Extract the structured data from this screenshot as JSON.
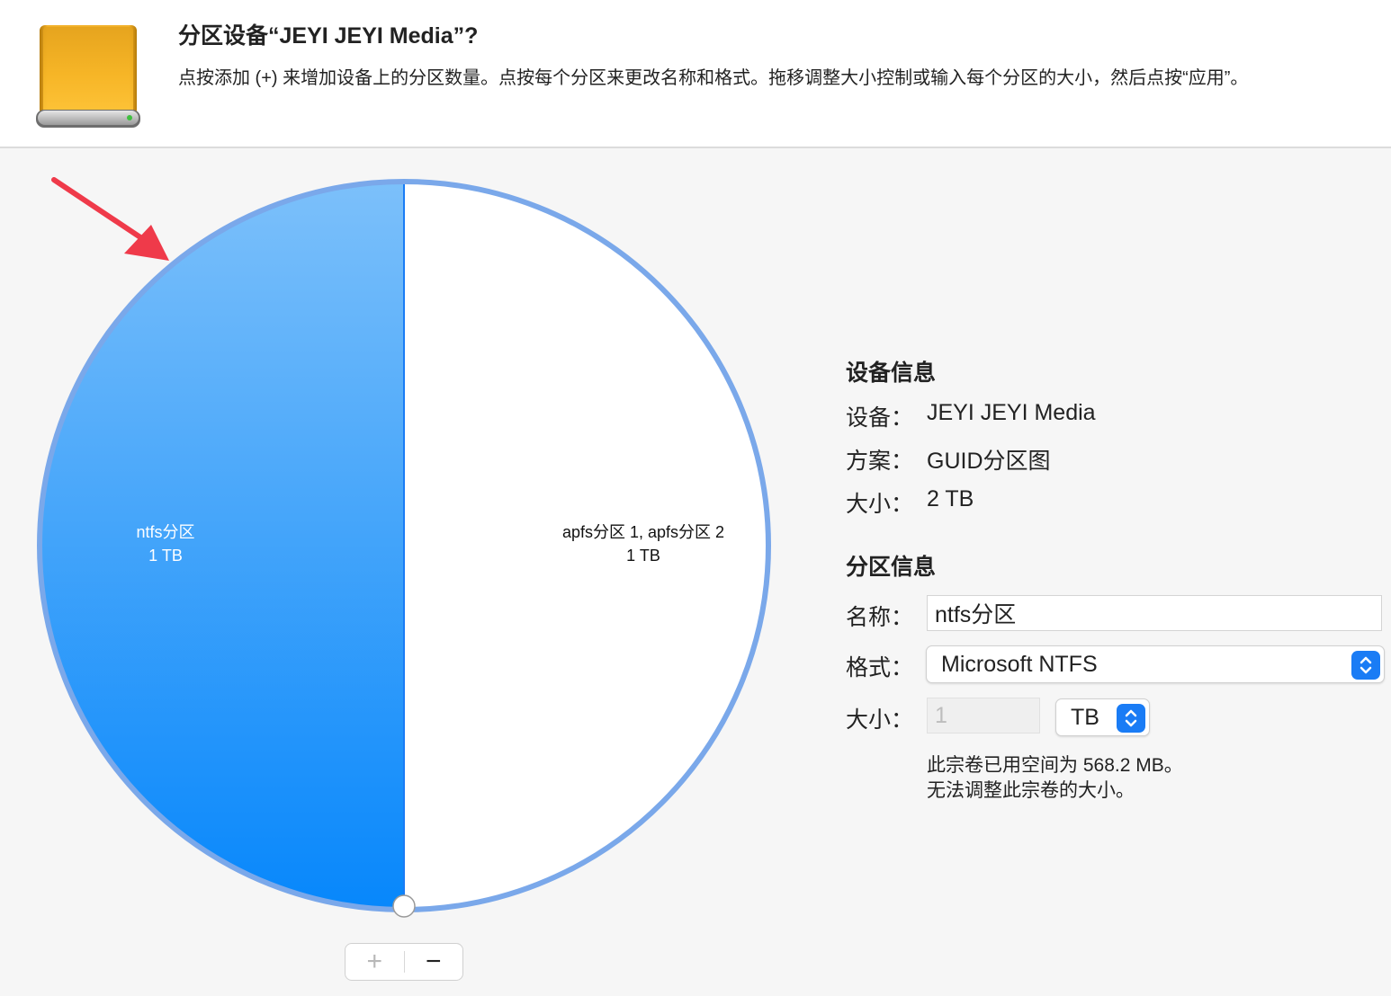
{
  "dialog": {
    "title": "分区设备“JEYI JEYI Media”?",
    "description": "点按添加 (+) 来增加设备上的分区数量。点按每个分区来更改名称和格式。拖移调整大小控制或输入每个分区的大小，然后点按“应用”。"
  },
  "icons": {
    "drive": "external-drive-icon",
    "arrow": "red-arrow-annotation",
    "stepper": "up-down-chevron-icon"
  },
  "pie": {
    "slices": [
      {
        "name": "ntfs分区",
        "size": "1 TB",
        "fraction": 0.5,
        "color": "#1a8cff",
        "selected": true
      },
      {
        "name": "apfs分区 1, apfs分区 2",
        "size": "1 TB",
        "fraction": 0.5,
        "color": "#ffffff",
        "selected": false
      }
    ],
    "add_label": "+",
    "remove_label": "−"
  },
  "device_info": {
    "title": "设备信息",
    "device_label": "设备：",
    "device_value": "JEYI JEYI Media",
    "scheme_label": "方案：",
    "scheme_value": "GUID分区图",
    "size_label": "大小：",
    "size_value": "2 TB"
  },
  "partition_info": {
    "title": "分区信息",
    "name_label": "名称：",
    "name_value": "ntfs分区",
    "format_label": "格式：",
    "format_value": "Microsoft NTFS",
    "size_label": "大小：",
    "size_value": "1",
    "unit_value": "TB",
    "note_line1": "此宗卷已用空间为 568.2 MB。",
    "note_line2": "无法调整此宗卷的大小。"
  },
  "colors": {
    "accent": "#1a7cf5",
    "selection_ring": "#7aa8ea",
    "annotation_arrow": "#ef3a4a"
  }
}
